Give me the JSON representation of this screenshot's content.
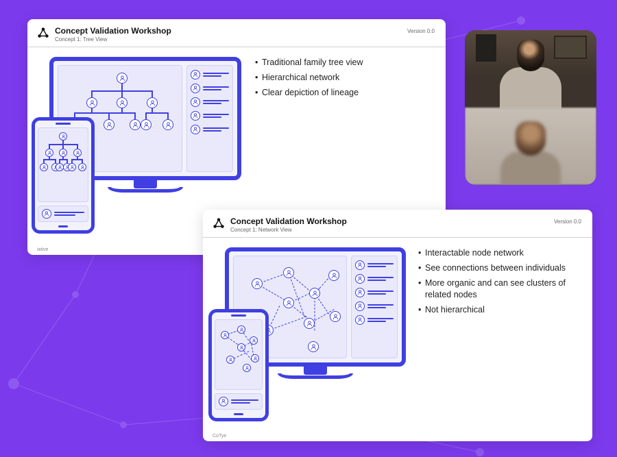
{
  "global": {
    "workshop_title": "Concept Validation Workshop",
    "version_label": "Version 0.0"
  },
  "slides": [
    {
      "id": "tree",
      "subtitle": "Concept 1: Tree View",
      "footer": "iative",
      "bullets": [
        "Traditional family tree view",
        "Hierarchical network",
        "Clear depiction of lineage"
      ]
    },
    {
      "id": "network",
      "subtitle": "Concept 1: Network View",
      "footer": "CoTye",
      "bullets": [
        "Interactable node network",
        "See connections between individuals",
        "More organic and can see clusters of related nodes",
        "Not hierarchical"
      ]
    }
  ],
  "video": {
    "participants": [
      "participant-1",
      "participant-2"
    ]
  },
  "icons": {
    "logo": "network-logo-icon",
    "person": "person-icon"
  },
  "colors": {
    "accent": "#3f3fe2",
    "background": "#7c3aed"
  }
}
